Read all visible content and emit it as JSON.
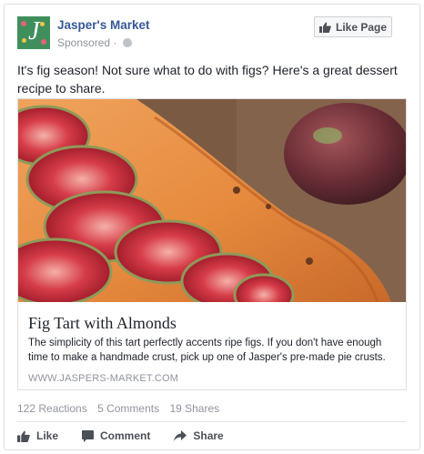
{
  "post": {
    "page_name": "Jasper's Market",
    "sponsored_label": "Sponsored",
    "sponsored_separator": "·",
    "like_page_label": "Like Page",
    "text": "It's fig season! Not sure what to do with figs? Here's a great dessert recipe to share."
  },
  "link": {
    "title": "Fig Tart with Almonds",
    "description": "The simplicity of this tart perfectly accents ripe figs. If you don't have enough time to make a handmade crust, pick up one of Jasper's pre-made pie crusts.",
    "domain": "WWW.JASPERS-MARKET.COM"
  },
  "stats": {
    "reactions": "122 Reactions",
    "comments": "5 Comments",
    "shares": "19 Shares"
  },
  "actions": {
    "like": "Like",
    "comment": "Comment",
    "share": "Share"
  },
  "colors": {
    "brand_blue": "#365899",
    "muted_text": "#90949c",
    "action_text": "#4b4f56"
  },
  "icons": {
    "avatar": "jaspers-market-logo",
    "globe": "globe-icon",
    "like_page": "thumbs-up-icon",
    "like": "thumbs-up-icon",
    "comment": "speech-bubble-icon",
    "share": "share-arrow-icon"
  }
}
